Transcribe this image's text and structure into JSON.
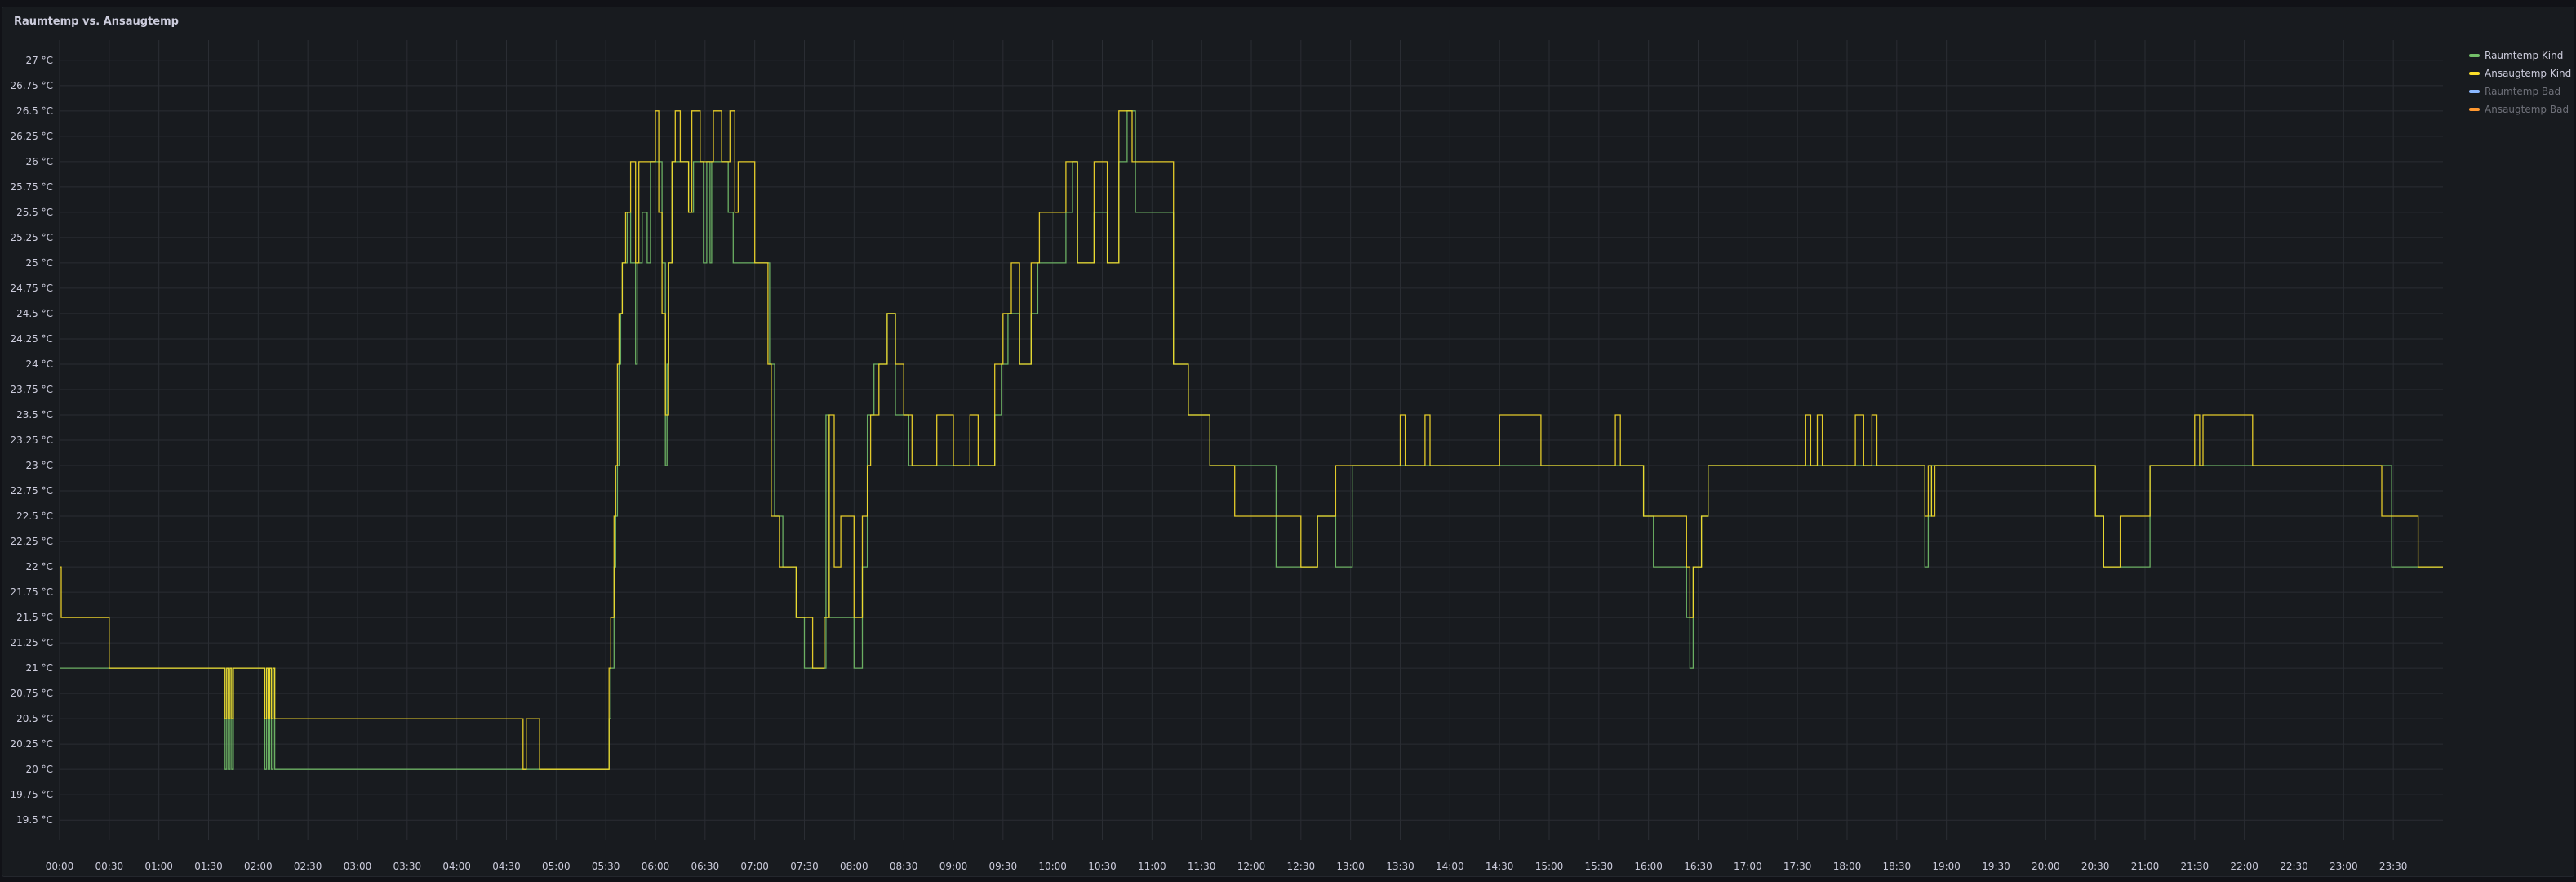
{
  "panel": {
    "title": "Raumtemp vs. Ansaugtemp"
  },
  "chart_data": {
    "type": "line",
    "title": "Raumtemp vs. Ansaugtemp",
    "xlabel": "",
    "ylabel": "",
    "x_ticks": [
      "00:00",
      "00:30",
      "01:00",
      "01:30",
      "02:00",
      "02:30",
      "03:00",
      "03:30",
      "04:00",
      "04:30",
      "05:00",
      "05:30",
      "06:00",
      "06:30",
      "07:00",
      "07:30",
      "08:00",
      "08:30",
      "09:00",
      "09:30",
      "10:00",
      "10:30",
      "11:00",
      "11:30",
      "12:00",
      "12:30",
      "13:00",
      "13:30",
      "14:00",
      "14:30",
      "15:00",
      "15:30",
      "16:00",
      "16:30",
      "17:00",
      "17:30",
      "18:00",
      "18:30",
      "19:00",
      "19:30",
      "20:00",
      "20:30",
      "21:00",
      "21:30",
      "22:00",
      "22:30",
      "23:00",
      "23:30"
    ],
    "y_ticks": [
      "19.5 °C",
      "19.75 °C",
      "20 °C",
      "20.25 °C",
      "20.5 °C",
      "20.75 °C",
      "21 °C",
      "21.25 °C",
      "21.5 °C",
      "21.75 °C",
      "22 °C",
      "22.25 °C",
      "22.5 °C",
      "22.75 °C",
      "23 °C",
      "23.25 °C",
      "23.5 °C",
      "23.75 °C",
      "24 °C",
      "24.25 °C",
      "24.5 °C",
      "24.75 °C",
      "25 °C",
      "25.25 °C",
      "25.5 °C",
      "25.75 °C",
      "26 °C",
      "26.25 °C",
      "26.5 °C",
      "26.75 °C",
      "27 °C"
    ],
    "ylim": [
      19.3,
      27.2
    ],
    "xlim": [
      "00:00",
      "24:00"
    ],
    "grid": true,
    "legend_position": "right",
    "step": true,
    "series": [
      {
        "name": "Raumtemp Kind",
        "color": "#73bf69",
        "points": [
          [
            "00:00",
            21.0
          ],
          [
            "00:30",
            21.0
          ],
          [
            "01:00",
            21.0
          ],
          [
            "01:30",
            21.0
          ],
          [
            "01:40",
            20.0
          ],
          [
            "01:41",
            21.0
          ],
          [
            "01:42",
            20.0
          ],
          [
            "01:43",
            21.0
          ],
          [
            "01:44",
            20.0
          ],
          [
            "01:45",
            21.0
          ],
          [
            "02:04",
            20.0
          ],
          [
            "02:05",
            21.0
          ],
          [
            "02:06",
            20.0
          ],
          [
            "02:07",
            21.0
          ],
          [
            "02:08",
            20.0
          ],
          [
            "02:09",
            21.0
          ],
          [
            "02:10",
            20.0
          ],
          [
            "05:32",
            20.5
          ],
          [
            "05:33",
            21.0
          ],
          [
            "05:35",
            22.0
          ],
          [
            "05:36",
            22.5
          ],
          [
            "05:37",
            23.0
          ],
          [
            "05:38",
            24.0
          ],
          [
            "05:39",
            24.5
          ],
          [
            "05:40",
            25.0
          ],
          [
            "05:43",
            25.5
          ],
          [
            "05:45",
            25.0
          ],
          [
            "05:48",
            24.0
          ],
          [
            "05:49",
            25.0
          ],
          [
            "05:52",
            25.5
          ],
          [
            "05:55",
            25.0
          ],
          [
            "05:57",
            26.0
          ],
          [
            "06:04",
            25.0
          ],
          [
            "06:06",
            23.0
          ],
          [
            "06:07",
            24.0
          ],
          [
            "06:08",
            25.0
          ],
          [
            "06:10",
            26.0
          ],
          [
            "06:20",
            25.5
          ],
          [
            "06:23",
            26.0
          ],
          [
            "06:29",
            25.0
          ],
          [
            "06:31",
            26.0
          ],
          [
            "06:33",
            25.0
          ],
          [
            "06:34",
            26.0
          ],
          [
            "06:44",
            25.5
          ],
          [
            "06:47",
            25.0
          ],
          [
            "07:00",
            25.0
          ],
          [
            "07:09",
            24.0
          ],
          [
            "07:12",
            22.5
          ],
          [
            "07:17",
            22.0
          ],
          [
            "07:25",
            21.5
          ],
          [
            "07:30",
            21.0
          ],
          [
            "07:42",
            21.0
          ],
          [
            "07:43",
            23.5
          ],
          [
            "07:45",
            21.5
          ],
          [
            "08:00",
            21.0
          ],
          [
            "08:05",
            22.0
          ],
          [
            "08:08",
            23.5
          ],
          [
            "08:12",
            24.0
          ],
          [
            "08:20",
            24.5
          ],
          [
            "08:25",
            23.5
          ],
          [
            "08:33",
            23.0
          ],
          [
            "09:00",
            23.0
          ],
          [
            "09:25",
            23.5
          ],
          [
            "09:29",
            24.0
          ],
          [
            "09:33",
            24.5
          ],
          [
            "09:40",
            24.0
          ],
          [
            "09:47",
            24.5
          ],
          [
            "09:51",
            25.0
          ],
          [
            "10:00",
            25.0
          ],
          [
            "10:08",
            25.5
          ],
          [
            "10:12",
            26.0
          ],
          [
            "10:15",
            25.0
          ],
          [
            "10:25",
            25.5
          ],
          [
            "10:33",
            25.0
          ],
          [
            "10:40",
            26.0
          ],
          [
            "10:45",
            26.5
          ],
          [
            "10:50",
            25.5
          ],
          [
            "11:00",
            25.5
          ],
          [
            "11:13",
            24.0
          ],
          [
            "11:22",
            23.5
          ],
          [
            "11:35",
            23.0
          ],
          [
            "11:50",
            23.0
          ],
          [
            "12:15",
            22.0
          ],
          [
            "12:30",
            22.0
          ],
          [
            "12:40",
            22.5
          ],
          [
            "12:51",
            22.0
          ],
          [
            "13:01",
            23.0
          ],
          [
            "13:30",
            23.0
          ],
          [
            "14:00",
            23.0
          ],
          [
            "14:30",
            23.0
          ],
          [
            "15:00",
            23.0
          ],
          [
            "15:40",
            23.0
          ],
          [
            "15:57",
            22.5
          ],
          [
            "16:03",
            22.0
          ],
          [
            "16:23",
            21.5
          ],
          [
            "16:25",
            21.0
          ],
          [
            "16:27",
            22.0
          ],
          [
            "16:32",
            22.5
          ],
          [
            "16:36",
            23.0
          ],
          [
            "17:00",
            23.0
          ],
          [
            "17:30",
            23.0
          ],
          [
            "18:00",
            23.0
          ],
          [
            "18:30",
            23.0
          ],
          [
            "18:47",
            22.0
          ],
          [
            "18:49",
            22.5
          ],
          [
            "18:51",
            23.0
          ],
          [
            "19:00",
            23.0
          ],
          [
            "19:30",
            23.0
          ],
          [
            "20:00",
            23.0
          ],
          [
            "20:30",
            22.5
          ],
          [
            "20:35",
            22.0
          ],
          [
            "20:45",
            22.0
          ],
          [
            "21:03",
            23.0
          ],
          [
            "21:30",
            23.0
          ],
          [
            "22:00",
            23.0
          ],
          [
            "22:30",
            23.0
          ],
          [
            "23:00",
            23.0
          ],
          [
            "23:23",
            23.0
          ],
          [
            "23:29",
            22.0
          ],
          [
            "23:45",
            22.0
          ],
          [
            "24:00",
            22.0
          ]
        ]
      },
      {
        "name": "Ansaugtemp Kind",
        "color": "#fade2a",
        "points": [
          [
            "00:00",
            22.0
          ],
          [
            "00:01",
            21.5
          ],
          [
            "00:30",
            21.0
          ],
          [
            "01:00",
            21.0
          ],
          [
            "01:30",
            21.0
          ],
          [
            "01:40",
            20.5
          ],
          [
            "01:41",
            21.0
          ],
          [
            "01:42",
            20.5
          ],
          [
            "01:43",
            21.0
          ],
          [
            "01:44",
            20.5
          ],
          [
            "01:45",
            21.0
          ],
          [
            "02:04",
            20.5
          ],
          [
            "02:05",
            21.0
          ],
          [
            "02:06",
            20.5
          ],
          [
            "02:07",
            21.0
          ],
          [
            "02:08",
            20.5
          ],
          [
            "02:09",
            21.0
          ],
          [
            "02:10",
            20.5
          ],
          [
            "04:40",
            20.0
          ],
          [
            "04:42",
            20.5
          ],
          [
            "04:50",
            20.0
          ],
          [
            "05:00",
            20.0
          ],
          [
            "05:30",
            20.0
          ],
          [
            "05:32",
            21.0
          ],
          [
            "05:33",
            21.5
          ],
          [
            "05:35",
            22.5
          ],
          [
            "05:36",
            23.0
          ],
          [
            "05:37",
            24.0
          ],
          [
            "05:38",
            24.5
          ],
          [
            "05:40",
            25.0
          ],
          [
            "05:42",
            25.5
          ],
          [
            "05:45",
            26.0
          ],
          [
            "05:48",
            25.0
          ],
          [
            "05:50",
            26.0
          ],
          [
            "05:55",
            26.0
          ],
          [
            "06:00",
            26.5
          ],
          [
            "06:02",
            25.5
          ],
          [
            "06:04",
            24.5
          ],
          [
            "06:06",
            23.5
          ],
          [
            "06:08",
            25.0
          ],
          [
            "06:10",
            26.0
          ],
          [
            "06:12",
            26.5
          ],
          [
            "06:15",
            26.0
          ],
          [
            "06:20",
            25.5
          ],
          [
            "06:22",
            26.5
          ],
          [
            "06:27",
            26.0
          ],
          [
            "06:35",
            26.5
          ],
          [
            "06:40",
            26.0
          ],
          [
            "06:45",
            26.5
          ],
          [
            "06:48",
            25.5
          ],
          [
            "06:50",
            26.0
          ],
          [
            "06:55",
            26.0
          ],
          [
            "07:00",
            25.0
          ],
          [
            "07:08",
            24.0
          ],
          [
            "07:10",
            22.5
          ],
          [
            "07:15",
            22.0
          ],
          [
            "07:25",
            21.5
          ],
          [
            "07:30",
            21.5
          ],
          [
            "07:35",
            21.0
          ],
          [
            "07:42",
            21.5
          ],
          [
            "07:45",
            23.5
          ],
          [
            "07:48",
            22.0
          ],
          [
            "07:52",
            22.5
          ],
          [
            "08:00",
            21.5
          ],
          [
            "08:05",
            22.5
          ],
          [
            "08:08",
            23.0
          ],
          [
            "08:10",
            23.5
          ],
          [
            "08:15",
            24.0
          ],
          [
            "08:20",
            24.5
          ],
          [
            "08:25",
            24.0
          ],
          [
            "08:30",
            23.5
          ],
          [
            "08:35",
            23.0
          ],
          [
            "08:50",
            23.5
          ],
          [
            "09:00",
            23.0
          ],
          [
            "09:10",
            23.5
          ],
          [
            "09:15",
            23.0
          ],
          [
            "09:25",
            24.0
          ],
          [
            "09:30",
            24.5
          ],
          [
            "09:35",
            25.0
          ],
          [
            "09:40",
            24.0
          ],
          [
            "09:47",
            25.0
          ],
          [
            "09:52",
            25.5
          ],
          [
            "10:00",
            25.5
          ],
          [
            "10:08",
            26.0
          ],
          [
            "10:15",
            25.0
          ],
          [
            "10:25",
            26.0
          ],
          [
            "10:33",
            25.0
          ],
          [
            "10:40",
            26.5
          ],
          [
            "10:48",
            26.0
          ],
          [
            "11:00",
            26.0
          ],
          [
            "11:13",
            24.0
          ],
          [
            "11:22",
            23.5
          ],
          [
            "11:35",
            23.0
          ],
          [
            "11:50",
            22.5
          ],
          [
            "12:15",
            22.5
          ],
          [
            "12:30",
            22.0
          ],
          [
            "12:40",
            22.5
          ],
          [
            "12:51",
            23.0
          ],
          [
            "13:01",
            23.0
          ],
          [
            "13:30",
            23.5
          ],
          [
            "13:33",
            23.0
          ],
          [
            "13:45",
            23.5
          ],
          [
            "13:48",
            23.0
          ],
          [
            "14:00",
            23.0
          ],
          [
            "14:30",
            23.5
          ],
          [
            "14:55",
            23.0
          ],
          [
            "15:00",
            23.0
          ],
          [
            "15:40",
            23.5
          ],
          [
            "15:43",
            23.0
          ],
          [
            "15:57",
            22.5
          ],
          [
            "16:03",
            22.5
          ],
          [
            "16:23",
            22.0
          ],
          [
            "16:25",
            21.5
          ],
          [
            "16:27",
            22.0
          ],
          [
            "16:32",
            22.5
          ],
          [
            "16:36",
            23.0
          ],
          [
            "17:00",
            23.0
          ],
          [
            "17:35",
            23.5
          ],
          [
            "17:38",
            23.0
          ],
          [
            "17:42",
            23.5
          ],
          [
            "17:45",
            23.0
          ],
          [
            "18:05",
            23.5
          ],
          [
            "18:10",
            23.0
          ],
          [
            "18:15",
            23.5
          ],
          [
            "18:18",
            23.0
          ],
          [
            "18:47",
            22.5
          ],
          [
            "18:49",
            23.0
          ],
          [
            "18:51",
            22.5
          ],
          [
            "18:53",
            23.0
          ],
          [
            "19:00",
            23.0
          ],
          [
            "19:30",
            23.0
          ],
          [
            "20:00",
            23.0
          ],
          [
            "20:30",
            22.5
          ],
          [
            "20:35",
            22.0
          ],
          [
            "20:45",
            22.5
          ],
          [
            "21:03",
            23.0
          ],
          [
            "21:30",
            23.5
          ],
          [
            "21:33",
            23.0
          ],
          [
            "21:35",
            23.5
          ],
          [
            "22:05",
            23.0
          ],
          [
            "22:30",
            23.0
          ],
          [
            "23:00",
            23.0
          ],
          [
            "23:23",
            22.5
          ],
          [
            "23:45",
            22.0
          ],
          [
            "24:00",
            22.0
          ]
        ]
      },
      {
        "name": "Raumtemp Bad",
        "color": "#8ab8ff",
        "points": []
      },
      {
        "name": "Ansaugtemp Bad",
        "color": "#ff9830",
        "points": []
      }
    ]
  },
  "legend": [
    {
      "label": "Raumtemp Kind",
      "color": "#73bf69",
      "active": true
    },
    {
      "label": "Ansaugtemp Kind",
      "color": "#fade2a",
      "active": true
    },
    {
      "label": "Raumtemp Bad",
      "color": "#8ab8ff",
      "active": false
    },
    {
      "label": "Ansaugtemp Bad",
      "color": "#ff9830",
      "active": false
    }
  ]
}
